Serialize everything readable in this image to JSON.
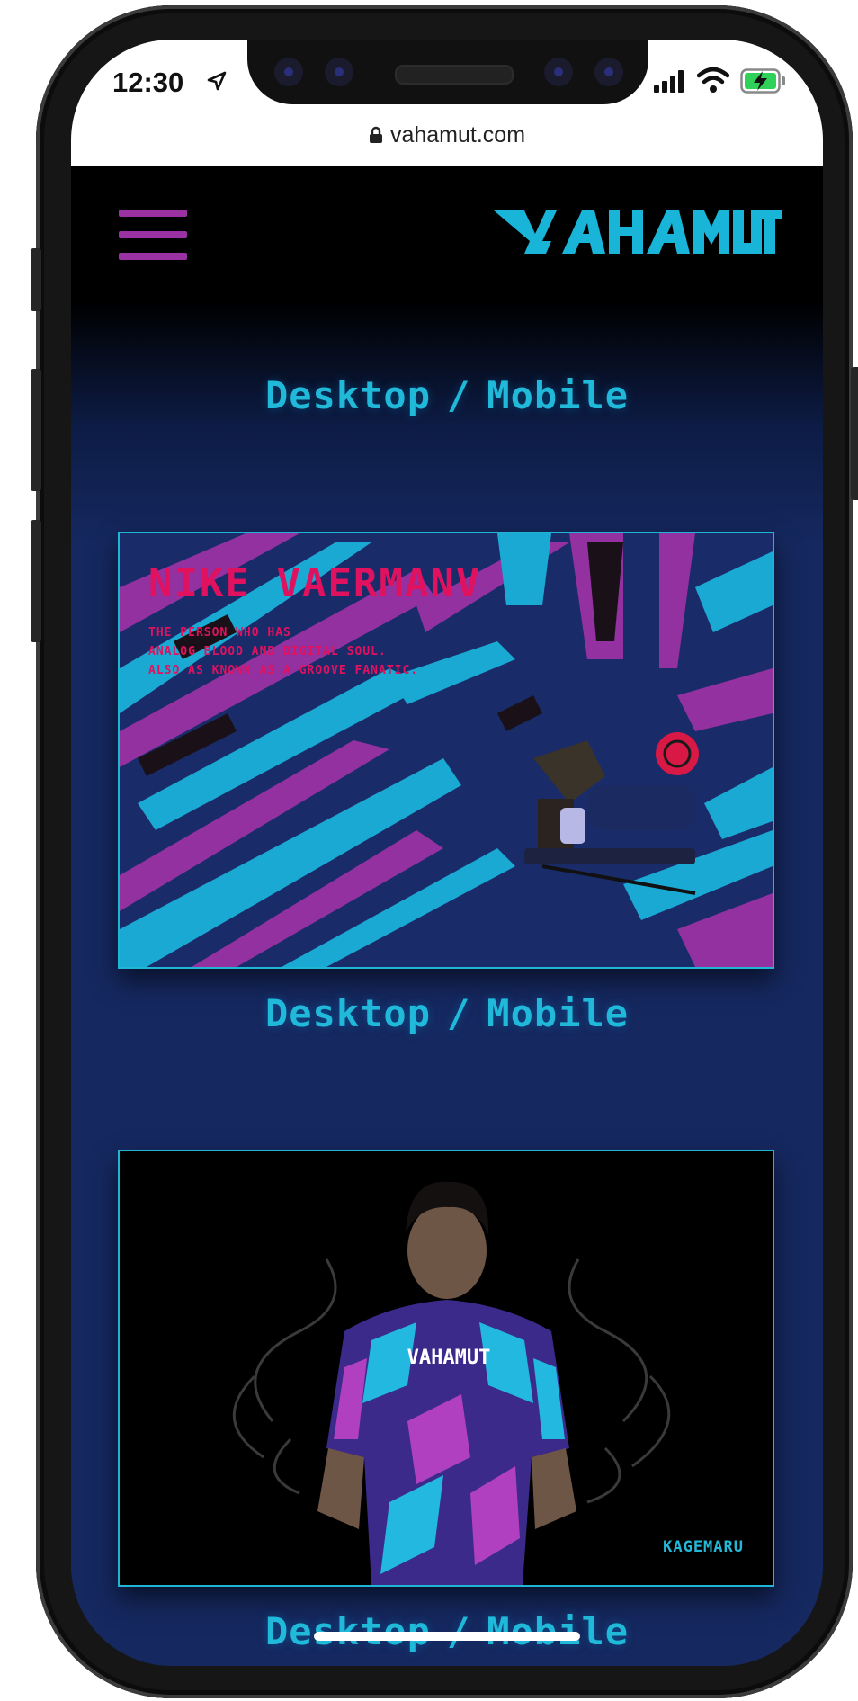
{
  "status_bar": {
    "time": "12:30"
  },
  "browser": {
    "url": "vahamut.com"
  },
  "site": {
    "logo_text": "VAHAMUT",
    "menu_icon": "hamburger-menu-icon",
    "captions": [
      {
        "desktop": "Desktop",
        "separator": "/",
        "mobile": "Mobile"
      },
      {
        "desktop": "Desktop",
        "separator": "/",
        "mobile": "Mobile"
      },
      {
        "desktop": "Desktop",
        "separator": "/",
        "mobile": "Mobile"
      }
    ],
    "cards": [
      {
        "title": "NIKE VAERMANV",
        "description_lines": [
          "THE PERSON WHO HAS",
          "ANALOG BLOOD AND DIGITAL SOUL.",
          "ALSO AS KNOWN AS A GROOVE FANATIC."
        ]
      },
      {
        "shirt_text": "VAHAMUT",
        "tag": "KAGEMARU"
      }
    ]
  },
  "colors": {
    "accent_cyan": "#20b9d9",
    "accent_purple": "#9a32a3",
    "accent_magenta": "#e0125f",
    "background_navy": "#15285f"
  }
}
